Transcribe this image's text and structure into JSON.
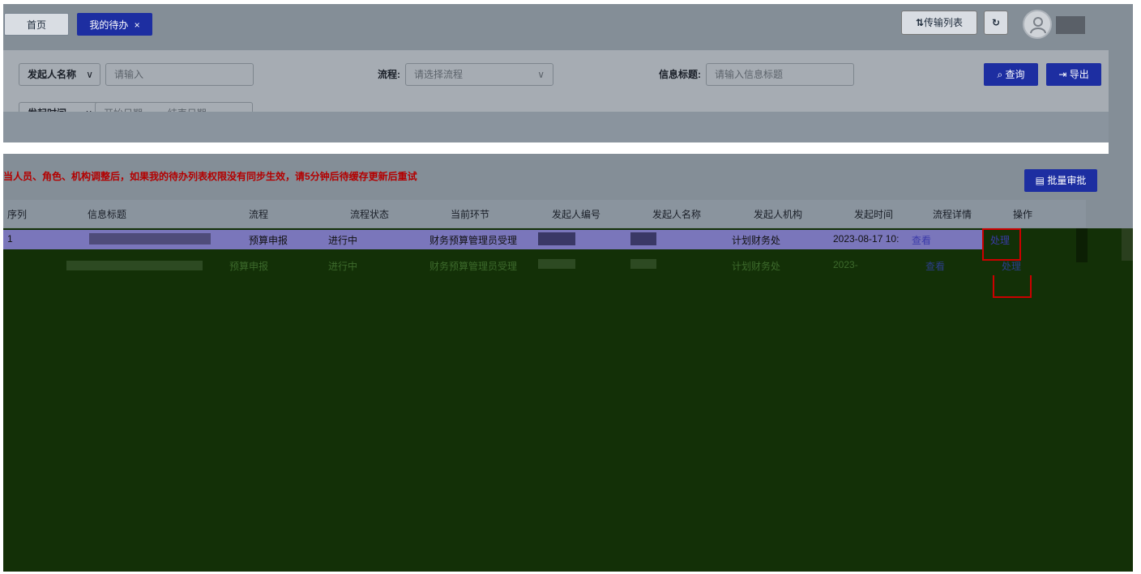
{
  "tabs": [
    {
      "label": "首页"
    },
    {
      "label": "我的待办",
      "close": "×"
    }
  ],
  "header": {
    "transfer_list": "传输列表",
    "transfer_icon": "sort-arrows-icon",
    "refresh_icon": "refresh-icon"
  },
  "filter": {
    "initiator_name_select": "发起人名称",
    "initiator_name_placeholder": "请输入",
    "process_label": "流程:",
    "process_placeholder": "请选择流程",
    "info_title_label": "信息标题:",
    "info_title_placeholder": "请输入信息标题",
    "time_select": "发起时间",
    "start_date_placeholder": "开始日期",
    "arrow": "→",
    "end_date_placeholder": "结束日期",
    "search_button": "查询",
    "export_button": "导出"
  },
  "notice": "当人员、角色、机构调整后，如果我的待办列表权限没有同步生效，请5分钟后待缓存更新后重试",
  "batch_approve": "批量审批",
  "table": {
    "columns": [
      "序列",
      "信息标题",
      "流程",
      "流程状态",
      "当前环节",
      "发起人编号",
      "发起人名称",
      "发起人机构",
      "发起时间",
      "流程详情",
      "操作"
    ],
    "rows": [
      {
        "seq": "1",
        "process": "预算申报",
        "status": "进行中",
        "step": "财务预算管理员受理",
        "org": "计划财务处",
        "time": "2023-08-17 10:",
        "detail": "查看",
        "action": "处理"
      },
      {
        "seq": "",
        "process": "预算申报",
        "status": "进行中",
        "step": "财务预算管理员受理",
        "org": "计划财务处",
        "time": "2023-",
        "detail": "查看",
        "action": "处理"
      }
    ]
  },
  "colors": {
    "accent": "#1d2ea1",
    "notice": "#b30000",
    "highlight_border": "#cc0000"
  }
}
